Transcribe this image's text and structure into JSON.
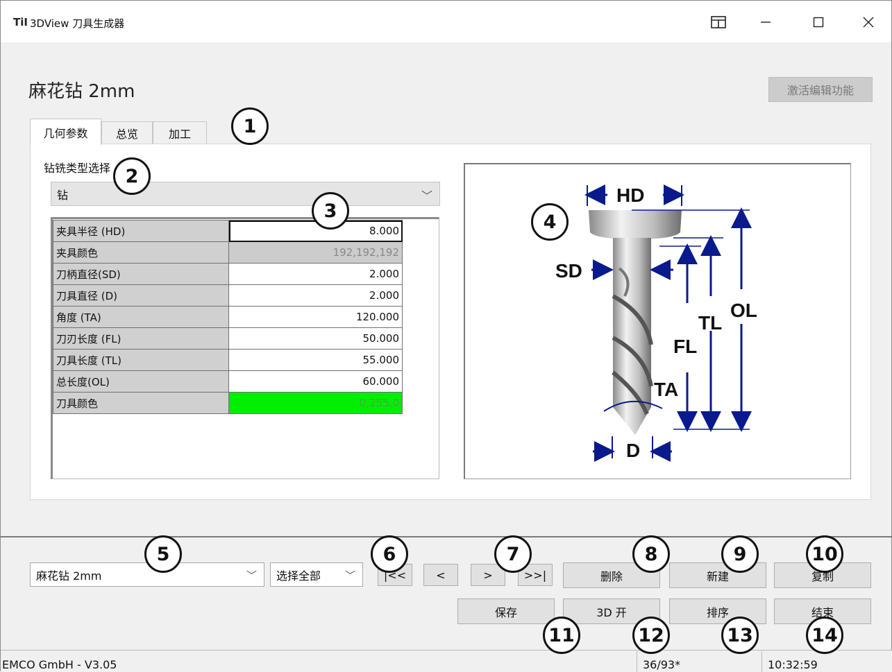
{
  "window": {
    "logo": "TiI",
    "title": "3DView 刀具生成器",
    "controls": [
      "layout-icon",
      "minimize-icon",
      "maximize-icon",
      "close-icon"
    ]
  },
  "header": {
    "tool_name": "麻花钻 2mm",
    "activate_edit": "激活编辑功能"
  },
  "tabs": [
    {
      "label": "几何参数",
      "active": true
    },
    {
      "label": "总览",
      "active": false
    },
    {
      "label": "加工",
      "active": false
    }
  ],
  "type_select": {
    "label": "钻铣类型选择",
    "value": "钻"
  },
  "params": [
    {
      "key": "夹具半径 (HD)",
      "value": "8.000"
    },
    {
      "key": "夹具颜色",
      "value": "192,192,192"
    },
    {
      "key": "刀柄直径(SD)",
      "value": "2.000"
    },
    {
      "key": "刀具直径 (D)",
      "value": "2.000"
    },
    {
      "key": "角度 (TA)",
      "value": "120.000"
    },
    {
      "key": "刀刃长度 (FL)",
      "value": "50.000"
    },
    {
      "key": "刀具长度 (TL)",
      "value": "55.000"
    },
    {
      "key": "总长度(OL)",
      "value": "60.000"
    },
    {
      "key": "刀具颜色",
      "value": "0,255,0"
    }
  ],
  "diagram": {
    "labels": {
      "hd": "HD",
      "sd": "SD",
      "ol": "OL",
      "tl": "TL",
      "fl": "FL",
      "ta": "TA",
      "d": "D"
    }
  },
  "bottom": {
    "tool_combo": "麻花钻 2mm",
    "select_combo": "选择全部",
    "nav": {
      "first": "|<<",
      "prev": "<",
      "next": ">",
      "last": ">>|"
    },
    "buttons": {
      "delete": "删除",
      "new": "新建",
      "copy": "复制",
      "save": "保存",
      "open3d": "3D 开",
      "sort": "排序",
      "end": "结束"
    }
  },
  "status": {
    "company": "EMCO GmbH  -  V3.05",
    "count": "36/93*",
    "time": "10:32:59"
  },
  "callouts": [
    "1",
    "2",
    "3",
    "4",
    "5",
    "6",
    "7",
    "8",
    "9",
    "10",
    "11",
    "12",
    "13",
    "14"
  ],
  "colors": {
    "window_bg": "#f0f0f0",
    "diagram_blue": "#0a1a8c",
    "tool_color": "#00ee00",
    "holder_color": "#c0c0c0"
  }
}
